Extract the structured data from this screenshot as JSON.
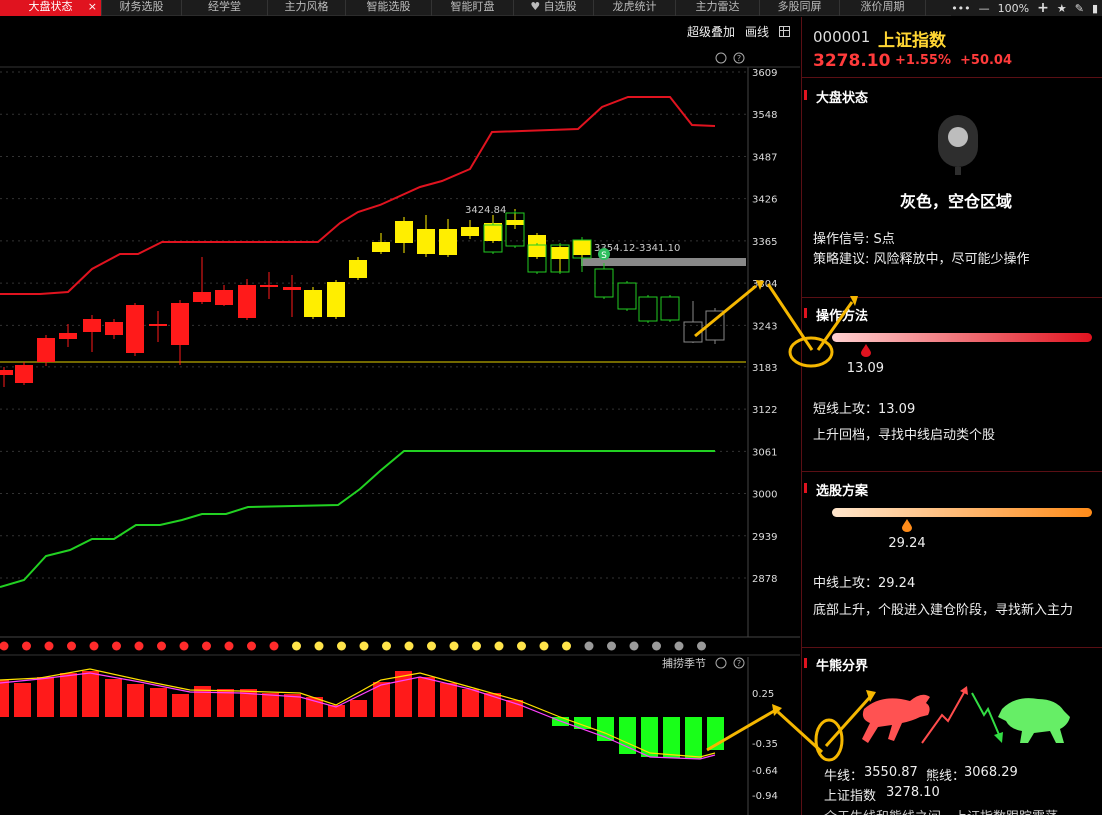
{
  "tabs": [
    {
      "label": "大盘状态",
      "active": true
    },
    {
      "label": "财务选股"
    },
    {
      "label": "经学堂"
    },
    {
      "label": "主力风格"
    },
    {
      "label": "智能选股"
    },
    {
      "label": "智能盯盘"
    },
    {
      "label": "♥ 自选股"
    },
    {
      "label": "龙虎统计"
    },
    {
      "label": "主力雷达"
    },
    {
      "label": "多股同屏"
    },
    {
      "label": "涨价周期"
    }
  ],
  "tab_close": "×",
  "tools": {
    "more": "•••",
    "minus": "—",
    "zoom": "100%",
    "plus": "+",
    "star": "★",
    "pen": "✎",
    "edit": "▮"
  },
  "chart_toolbar": {
    "overlay": "超级叠加",
    "draw": "画线",
    "grid_icon": "grid-icon"
  },
  "main_chart": {
    "type": "candlestick",
    "y_ticks": [
      "3609",
      "3548",
      "3487",
      "3426",
      "3365",
      "3304",
      "3243",
      "3183",
      "3122",
      "3061",
      "3000",
      "2939",
      "2878"
    ],
    "annotation_high": "3424.84",
    "annotation_range": "3354.12-3341.10",
    "marker_s": "S",
    "colors": {
      "upper_band": "#e0131f",
      "lower_band": "#22d122",
      "bull": "#ff1a1a",
      "yellow": "#ffee00",
      "bear_outline": "#22cc22",
      "gray": "#888888",
      "level_line": "#e6d200"
    }
  },
  "dots": {
    "colors": [
      "#ff2b2b",
      "#ff2b2b",
      "#ff2b2b",
      "#ff2b2b",
      "#ff2b2b",
      "#ff2b2b",
      "#ff2b2b",
      "#ff2b2b",
      "#ff2b2b",
      "#ff2b2b",
      "#ff2b2b",
      "#ff2b2b",
      "#ff2b2b",
      "#ffe44a",
      "#ffe44a",
      "#ffe44a",
      "#ffe44a",
      "#ffe44a",
      "#ffe44a",
      "#ffe44a",
      "#ffe44a",
      "#ffe44a",
      "#ffe44a",
      "#ffe44a",
      "#ffe44a",
      "#ffe44a",
      "#9a9a9a",
      "#9a9a9a",
      "#9a9a9a",
      "#9a9a9a",
      "#9a9a9a",
      "#9a9a9a"
    ]
  },
  "sub_chart": {
    "title": "捕捞季节",
    "y_ticks": [
      "0.25",
      "-0.35",
      "-0.64",
      "-0.94"
    ]
  },
  "panel": {
    "code": "000001",
    "name": "上证指数",
    "price": "3278.10",
    "pct": "+1.55%",
    "change": "+50.04",
    "market": {
      "title": "大盘状态",
      "state": "灰色，空仓区域",
      "signal": "操作信号: S点",
      "advice": "策略建议: 风险释放中，尽可能少操作"
    },
    "method": {
      "title": "操作方法",
      "marker_value": "13.09",
      "marker_fraction": 0.13,
      "line1": "短线上攻：13.09",
      "line2": "上升回档，寻找中线启动类个股"
    },
    "selection": {
      "title": "选股方案",
      "marker_value": "29.24",
      "marker_fraction": 0.29,
      "line1": "中线上攻：29.24",
      "line2": "底部上升，个股进入建仓阶段，寻找新入主力"
    },
    "bull_bear": {
      "title": "牛熊分界",
      "bull_label": "牛线：",
      "bull_value": "3550.87",
      "bear_label": "熊线：",
      "bear_value": "3068.29",
      "index_label": "上证指数",
      "index_value": "3278.10",
      "note": "介于牛线和熊线之间，上证指数跟踪震荡"
    }
  }
}
